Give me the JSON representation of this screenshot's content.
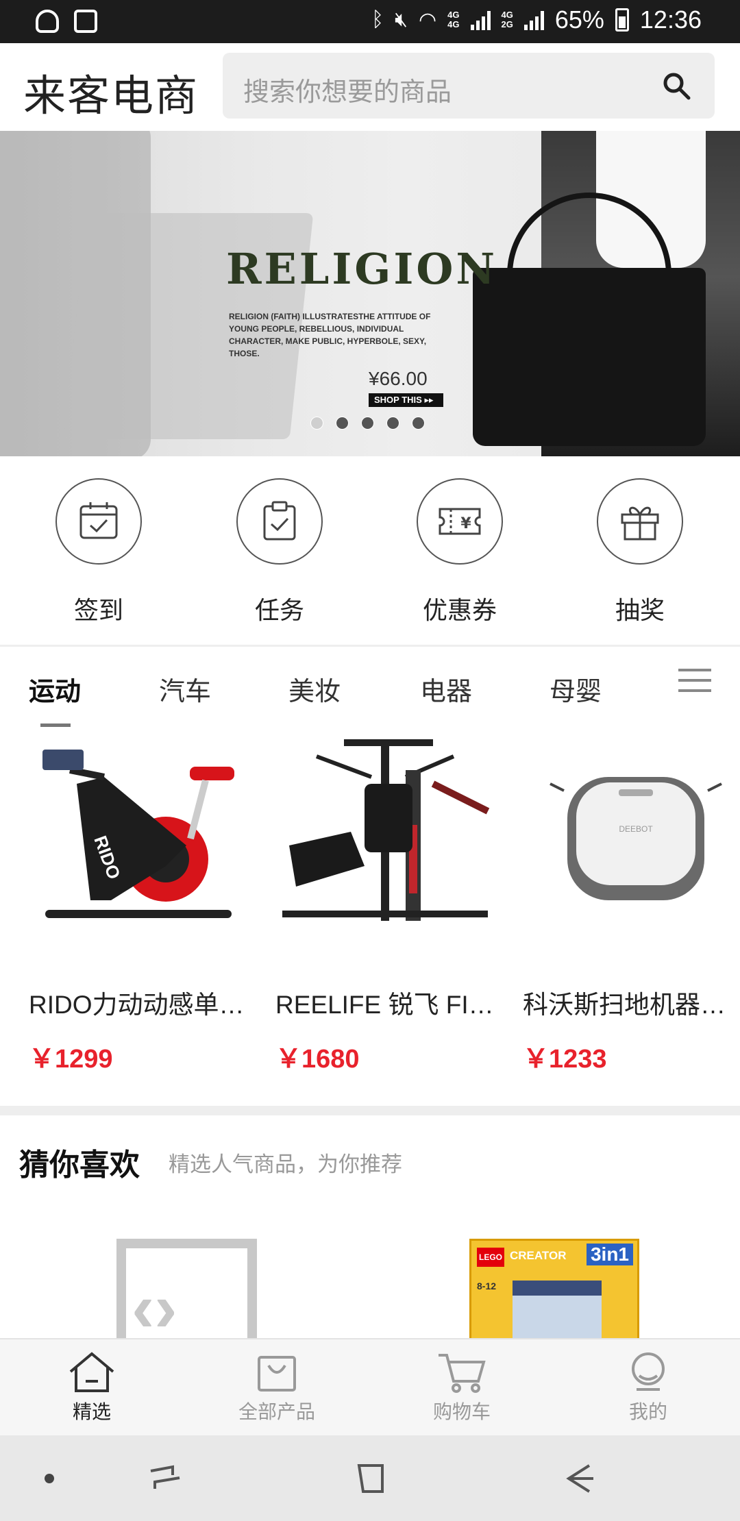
{
  "status_bar": {
    "battery": "65%",
    "time": "12:36",
    "network_top": "4G",
    "network_bottom": "2G"
  },
  "header": {
    "logo": "来客电商",
    "search_placeholder": "搜索你想要的商品"
  },
  "banner": {
    "title": "RELIGION",
    "description": "RELIGION (FAITH) ILLUSTRATESTHE ATTITUDE OF YOUNG PEOPLE, REBELLIOUS, INDIVIDUAL CHARACTER, MAKE PUBLIC, HYPERBOLE, SEXY, THOSE.",
    "price": "¥66.00",
    "cta": "SHOP THIS ▸▸",
    "slides": 5,
    "active_slide": 0
  },
  "quick_actions": [
    {
      "label": "签到",
      "icon": "calendar-check-icon"
    },
    {
      "label": "任务",
      "icon": "clipboard-check-icon"
    },
    {
      "label": "优惠券",
      "icon": "coupon-icon"
    },
    {
      "label": "抽奖",
      "icon": "gift-icon"
    }
  ],
  "category_tabs": [
    {
      "label": "运动",
      "active": true
    },
    {
      "label": "汽车",
      "active": false
    },
    {
      "label": "美妆",
      "active": false
    },
    {
      "label": "电器",
      "active": false
    },
    {
      "label": "母婴",
      "active": false
    }
  ],
  "products": [
    {
      "name": "RIDO力动动感单…",
      "price": "￥1299",
      "image": "exercise-bike"
    },
    {
      "name": "REELIFE 锐飞 FIT…",
      "price": "￥1680",
      "image": "home-gym-station"
    },
    {
      "name": "科沃斯扫地机器…",
      "price": "￥1233",
      "image": "robot-vacuum"
    }
  ],
  "recommend": {
    "title": "猜你喜欢",
    "subtitle": "精选人气商品，为你推荐",
    "items": [
      {
        "image": "brand-logo-placeholder"
      },
      {
        "image": "lego-creator-box",
        "brand": "LEGO",
        "line": "CREATOR",
        "badge": "3in1",
        "age": "8-12"
      }
    ]
  },
  "bottom_nav": [
    {
      "label": "精选",
      "icon": "home-icon",
      "active": true
    },
    {
      "label": "全部产品",
      "icon": "bag-icon",
      "active": false
    },
    {
      "label": "购物车",
      "icon": "cart-icon",
      "active": false
    },
    {
      "label": "我的",
      "icon": "user-icon",
      "active": false
    }
  ],
  "colors": {
    "price_red": "#e8222c",
    "status_bar": "#1c1c1c",
    "search_bg": "#eeeeee"
  }
}
